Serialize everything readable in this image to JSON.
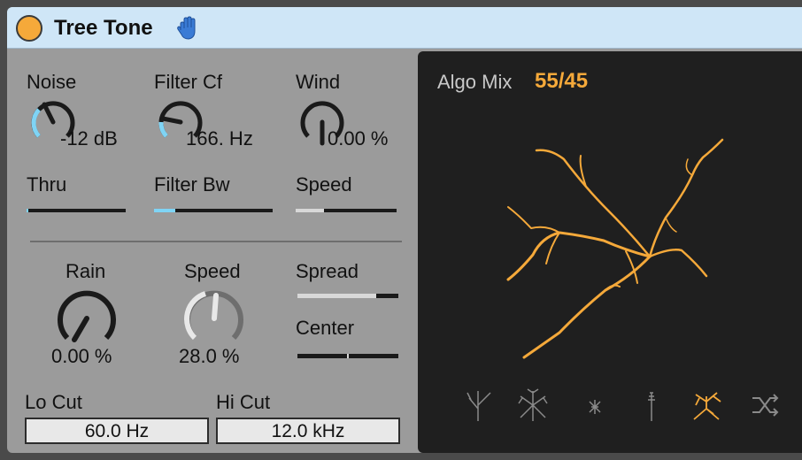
{
  "device": {
    "title": "Tree Tone",
    "colors": {
      "accent": "#f5a93a",
      "knob_arc": "#7fd4f5",
      "panel": "#9b9b9b",
      "titlebar": "#cfe6f7",
      "display_bg": "#1f1f1f"
    }
  },
  "controls": {
    "noise": {
      "label": "Noise",
      "value": "-12 dB",
      "level": 0.45
    },
    "filter_cf": {
      "label": "Filter Cf",
      "value": "166. Hz",
      "level": 0.3
    },
    "wind": {
      "label": "Wind",
      "value": "0.00 %",
      "level": 0.0
    },
    "thru": {
      "label": "Thru",
      "level": 0.02
    },
    "filter_bw": {
      "label": "Filter Bw",
      "level": 0.18
    },
    "speed_top": {
      "label": "Speed",
      "level": 0.28
    },
    "rain": {
      "label": "Rain",
      "value": "0.00 %",
      "level": 0.0
    },
    "speed": {
      "label": "Speed",
      "value": "28.0 %",
      "level": 0.28
    },
    "spread": {
      "label": "Spread",
      "level": 0.78
    },
    "center": {
      "label": "Center",
      "level": 0.5
    },
    "lo_cut": {
      "label": "Lo Cut",
      "value": "60.0 Hz"
    },
    "hi_cut": {
      "label": "Hi Cut",
      "value": "12.0 kHz"
    }
  },
  "display": {
    "algo_label": "Algo Mix",
    "algo_value": "55/45",
    "presets": [
      "tree-1-icon",
      "tree-2-icon",
      "tree-3-icon",
      "tree-4-icon",
      "tree-5-icon",
      "shuffle-icon"
    ],
    "selected_preset": 4
  }
}
